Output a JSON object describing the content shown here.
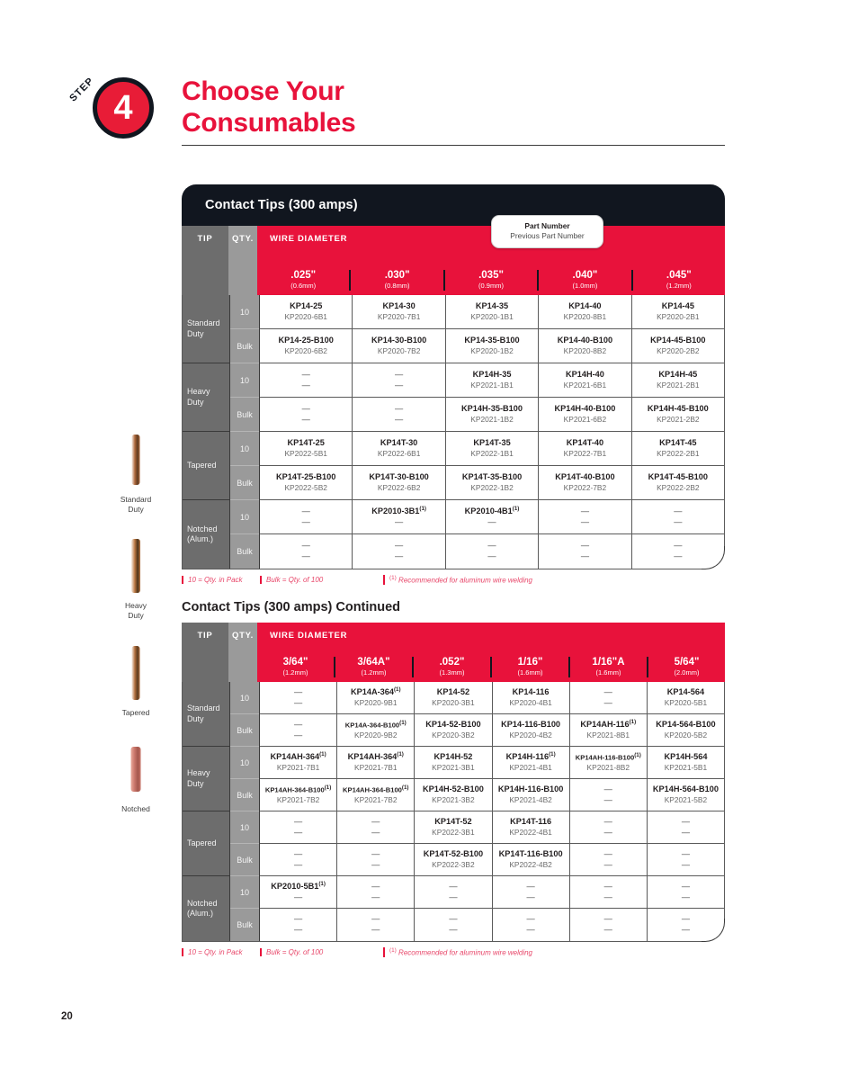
{
  "step": {
    "word": "STEP",
    "number": "4"
  },
  "page_title": {
    "line1": "Choose Your",
    "line2": "Consumables"
  },
  "page_number": "20",
  "colors": {
    "red": "#E8123B",
    "navy": "#11161f",
    "tip_col": "#6d6d6d",
    "qty_col": "#9a9a9a"
  },
  "callout": {
    "line1": "Part Number",
    "line2": "Previous Part Number"
  },
  "tip_gallery": [
    {
      "label_line1": "Standard",
      "label_line2": "Duty",
      "name": "standard-duty-tip-photo"
    },
    {
      "label_line1": "Heavy",
      "label_line2": "Duty",
      "name": "heavy-duty-tip-photo"
    },
    {
      "label_line1": "Tapered",
      "label_line2": "",
      "name": "tapered-tip-photo"
    },
    {
      "label_line1": "Notched",
      "label_line2": "",
      "name": "notched-tip-photo"
    }
  ],
  "legend": {
    "pack": "10 = Qty. in Pack",
    "bulk": "Bulk = Qty. of 100",
    "footnote_marker": "(1)",
    "footnote": "Recommended for aluminum wire welding"
  },
  "table1": {
    "title": "Contact Tips (300 amps)",
    "header": {
      "tip": "TIP",
      "qty": "QTY.",
      "wire_diameter": "WIRE DIAMETER"
    },
    "columns": [
      {
        "size": ".025\"",
        "metric": "(0.6mm)"
      },
      {
        "size": ".030\"",
        "metric": "(0.8mm)"
      },
      {
        "size": ".035\"",
        "metric": "(0.9mm)"
      },
      {
        "size": ".040\"",
        "metric": "(1.0mm)"
      },
      {
        "size": ".045\"",
        "metric": "(1.2mm)"
      }
    ],
    "groups": [
      {
        "label_line1": "Standard",
        "label_line2": "Duty",
        "rows": [
          {
            "qty": "10",
            "cells": [
              {
                "pn": "KP14-25",
                "ppn": "KP2020-6B1"
              },
              {
                "pn": "KP14-30",
                "ppn": "KP2020-7B1"
              },
              {
                "pn": "KP14-35",
                "ppn": "KP2020-1B1"
              },
              {
                "pn": "KP14-40",
                "ppn": "KP2020-8B1"
              },
              {
                "pn": "KP14-45",
                "ppn": "KP2020-2B1"
              }
            ]
          },
          {
            "qty": "Bulk",
            "cells": [
              {
                "pn": "KP14-25-B100",
                "ppn": "KP2020-6B2"
              },
              {
                "pn": "KP14-30-B100",
                "ppn": "KP2020-7B2"
              },
              {
                "pn": "KP14-35-B100",
                "ppn": "KP2020-1B2"
              },
              {
                "pn": "KP14-40-B100",
                "ppn": "KP2020-8B2"
              },
              {
                "pn": "KP14-45-B100",
                "ppn": "KP2020-2B2"
              }
            ]
          }
        ]
      },
      {
        "label_line1": "Heavy",
        "label_line2": "Duty",
        "rows": [
          {
            "qty": "10",
            "cells": [
              {
                "pn": "—",
                "ppn": "—"
              },
              {
                "pn": "—",
                "ppn": "—"
              },
              {
                "pn": "KP14H-35",
                "ppn": "KP2021-1B1"
              },
              {
                "pn": "KP14H-40",
                "ppn": "KP2021-6B1"
              },
              {
                "pn": "KP14H-45",
                "ppn": "KP2021-2B1"
              }
            ]
          },
          {
            "qty": "Bulk",
            "cells": [
              {
                "pn": "—",
                "ppn": "—"
              },
              {
                "pn": "—",
                "ppn": "—"
              },
              {
                "pn": "KP14H-35-B100",
                "ppn": "KP2021-1B2"
              },
              {
                "pn": "KP14H-40-B100",
                "ppn": "KP2021-6B2"
              },
              {
                "pn": "KP14H-45-B100",
                "ppn": "KP2021-2B2"
              }
            ]
          }
        ]
      },
      {
        "label_line1": "Tapered",
        "label_line2": "",
        "rows": [
          {
            "qty": "10",
            "cells": [
              {
                "pn": "KP14T-25",
                "ppn": "KP2022-5B1"
              },
              {
                "pn": "KP14T-30",
                "ppn": "KP2022-6B1"
              },
              {
                "pn": "KP14T-35",
                "ppn": "KP2022-1B1"
              },
              {
                "pn": "KP14T-40",
                "ppn": "KP2022-7B1"
              },
              {
                "pn": "KP14T-45",
                "ppn": "KP2022-2B1"
              }
            ]
          },
          {
            "qty": "Bulk",
            "cells": [
              {
                "pn": "KP14T-25-B100",
                "ppn": "KP2022-5B2"
              },
              {
                "pn": "KP14T-30-B100",
                "ppn": "KP2022-6B2"
              },
              {
                "pn": "KP14T-35-B100",
                "ppn": "KP2022-1B2"
              },
              {
                "pn": "KP14T-40-B100",
                "ppn": "KP2022-7B2"
              },
              {
                "pn": "KP14T-45-B100",
                "ppn": "KP2022-2B2"
              }
            ]
          }
        ]
      },
      {
        "label_line1": "Notched",
        "label_line2": "(Alum.)",
        "rows": [
          {
            "qty": "10",
            "cells": [
              {
                "pn": "—",
                "ppn": "—"
              },
              {
                "pn": "KP2010-3B1",
                "sup": "(1)",
                "ppn": "—"
              },
              {
                "pn": "KP2010-4B1",
                "sup": "(1)",
                "ppn": "—"
              },
              {
                "pn": "—",
                "ppn": "—"
              },
              {
                "pn": "—",
                "ppn": "—"
              }
            ]
          },
          {
            "qty": "Bulk",
            "cells": [
              {
                "pn": "—",
                "ppn": "—"
              },
              {
                "pn": "—",
                "ppn": "—"
              },
              {
                "pn": "—",
                "ppn": "—"
              },
              {
                "pn": "—",
                "ppn": "—"
              },
              {
                "pn": "—",
                "ppn": "—"
              }
            ]
          }
        ]
      }
    ]
  },
  "table2": {
    "title": "Contact Tips (300 amps) Continued",
    "header": {
      "tip": "TIP",
      "qty": "QTY.",
      "wire_diameter": "WIRE DIAMETER"
    },
    "columns": [
      {
        "size": "3/64\"",
        "metric": "(1.2mm)"
      },
      {
        "size": "3/64A\"",
        "metric": "(1.2mm)"
      },
      {
        "size": ".052\"",
        "metric": "(1.3mm)"
      },
      {
        "size": "1/16\"",
        "metric": "(1.6mm)"
      },
      {
        "size": "1/16\"A",
        "metric": "(1.6mm)"
      },
      {
        "size": "5/64\"",
        "metric": "(2.0mm)"
      }
    ],
    "groups": [
      {
        "label_line1": "Standard",
        "label_line2": "Duty",
        "rows": [
          {
            "qty": "10",
            "cells": [
              {
                "pn": "—",
                "ppn": "—"
              },
              {
                "pn": "KP14A-364",
                "sup": "(1)",
                "ppn": "KP2020-9B1"
              },
              {
                "pn": "KP14-52",
                "ppn": "KP2020-3B1"
              },
              {
                "pn": "KP14-116",
                "ppn": "KP2020-4B1"
              },
              {
                "pn": "—",
                "ppn": "—"
              },
              {
                "pn": "KP14-564",
                "ppn": "KP2020-5B1"
              }
            ]
          },
          {
            "qty": "Bulk",
            "cells": [
              {
                "pn": "—",
                "ppn": "—"
              },
              {
                "pn": "KP14A-364-B100",
                "sup": "(1)",
                "small": true,
                "ppn": "KP2020-9B2"
              },
              {
                "pn": "KP14-52-B100",
                "ppn": "KP2020-3B2"
              },
              {
                "pn": "KP14-116-B100",
                "ppn": "KP2020-4B2"
              },
              {
                "pn": "KP14AH-116",
                "sup": "(1)",
                "ppn": "KP2021-8B1"
              },
              {
                "pn": "KP14-564-B100",
                "ppn": "KP2020-5B2"
              }
            ]
          }
        ]
      },
      {
        "label_line1": "Heavy",
        "label_line2": "Duty",
        "rows": [
          {
            "qty": "10",
            "cells": [
              {
                "pn": "KP14AH-364",
                "sup": "(1)",
                "ppn": "KP2021-7B1"
              },
              {
                "pn": "KP14AH-364",
                "sup": "(1)",
                "ppn": "KP2021-7B1"
              },
              {
                "pn": "KP14H-52",
                "ppn": "KP2021-3B1"
              },
              {
                "pn": "KP14H-116",
                "sup": "(1)",
                "ppn": "KP2021-4B1"
              },
              {
                "pn": "KP14AH-116-B100",
                "sup": "(1)",
                "small": true,
                "ppn": "KP2021-8B2"
              },
              {
                "pn": "KP14H-564",
                "ppn": "KP2021-5B1"
              }
            ]
          },
          {
            "qty": "Bulk",
            "cells": [
              {
                "pn": "KP14AH-364-B100",
                "sup": "(1)",
                "small": true,
                "ppn": "KP2021-7B2"
              },
              {
                "pn": "KP14AH-364-B100",
                "sup": "(1)",
                "small": true,
                "ppn": "KP2021-7B2"
              },
              {
                "pn": "KP14H-52-B100",
                "ppn": "KP2021-3B2"
              },
              {
                "pn": "KP14H-116-B100",
                "ppn": "KP2021-4B2"
              },
              {
                "pn": "—",
                "ppn": "—"
              },
              {
                "pn": "KP14H-564-B100",
                "ppn": "KP2021-5B2"
              }
            ]
          }
        ]
      },
      {
        "label_line1": "Tapered",
        "label_line2": "",
        "rows": [
          {
            "qty": "10",
            "cells": [
              {
                "pn": "—",
                "ppn": "—"
              },
              {
                "pn": "—",
                "ppn": "—"
              },
              {
                "pn": "KP14T-52",
                "ppn": "KP2022-3B1"
              },
              {
                "pn": "KP14T-116",
                "ppn": "KP2022-4B1"
              },
              {
                "pn": "—",
                "ppn": "—"
              },
              {
                "pn": "—",
                "ppn": "—"
              }
            ]
          },
          {
            "qty": "Bulk",
            "cells": [
              {
                "pn": "—",
                "ppn": "—"
              },
              {
                "pn": "—",
                "ppn": "—"
              },
              {
                "pn": "KP14T-52-B100",
                "ppn": "KP2022-3B2"
              },
              {
                "pn": "KP14T-116-B100",
                "ppn": "KP2022-4B2"
              },
              {
                "pn": "—",
                "ppn": "—"
              },
              {
                "pn": "—",
                "ppn": "—"
              }
            ]
          }
        ]
      },
      {
        "label_line1": "Notched",
        "label_line2": "(Alum.)",
        "rows": [
          {
            "qty": "10",
            "cells": [
              {
                "pn": "KP2010-5B1",
                "sup": "(1)",
                "ppn": "—"
              },
              {
                "pn": "—",
                "ppn": "—"
              },
              {
                "pn": "—",
                "ppn": "—"
              },
              {
                "pn": "—",
                "ppn": "—"
              },
              {
                "pn": "—",
                "ppn": "—"
              },
              {
                "pn": "—",
                "ppn": "—"
              }
            ]
          },
          {
            "qty": "Bulk",
            "cells": [
              {
                "pn": "—",
                "ppn": "—"
              },
              {
                "pn": "—",
                "ppn": "—"
              },
              {
                "pn": "—",
                "ppn": "—"
              },
              {
                "pn": "—",
                "ppn": "—"
              },
              {
                "pn": "—",
                "ppn": "—"
              },
              {
                "pn": "—",
                "ppn": "—"
              }
            ]
          }
        ]
      }
    ]
  }
}
